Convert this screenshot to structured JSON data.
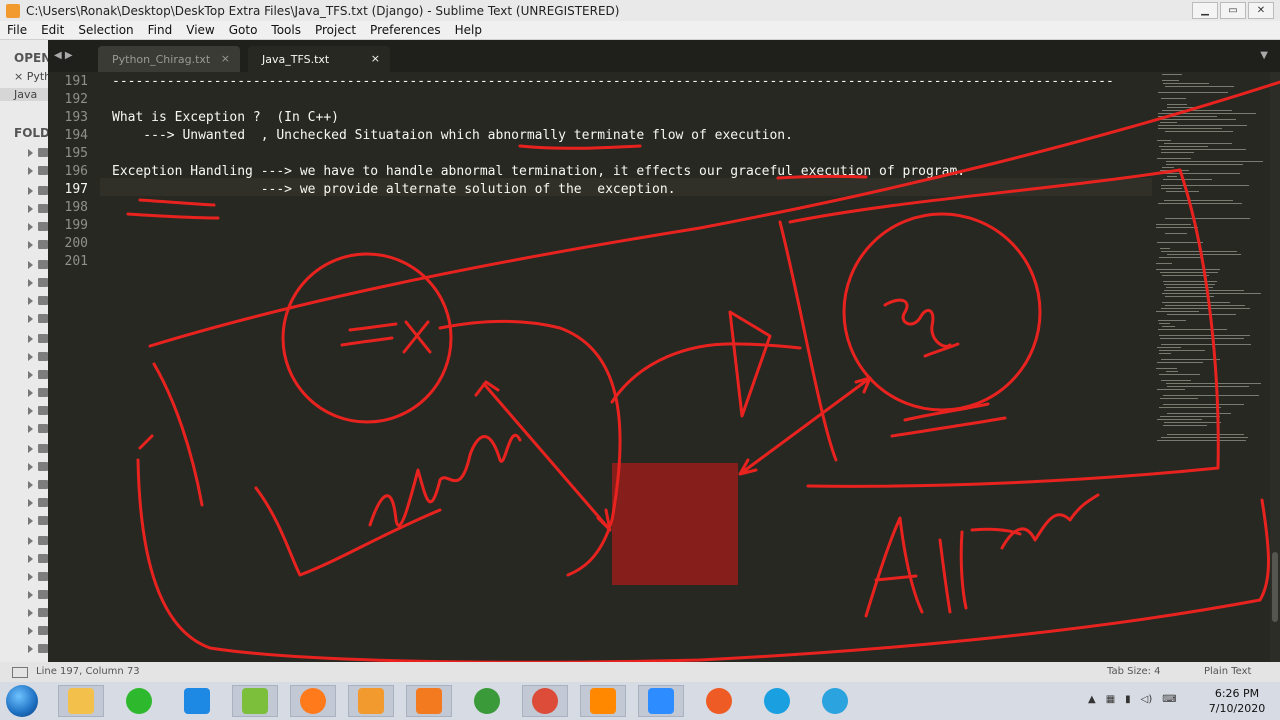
{
  "window": {
    "title": "C:\\Users\\Ronak\\Desktop\\DeskTop Extra Files\\Java_TFS.txt (Django) - Sublime Text (UNREGISTERED)",
    "minimize": "▁",
    "restore": "▭",
    "close": "✕"
  },
  "menu": [
    "File",
    "Edit",
    "Selection",
    "Find",
    "View",
    "Goto",
    "Tools",
    "Project",
    "Preferences",
    "Help"
  ],
  "sidebar": {
    "open_header": "OPEN",
    "open_files": [
      {
        "label": "× Pyth",
        "active": false
      },
      {
        "label": "Java",
        "active": true
      }
    ],
    "folders_header": "FOLD"
  },
  "tabs": [
    {
      "label": "Python_Chirag.txt",
      "close": "×",
      "active": false
    },
    {
      "label": "Java_TFS.txt",
      "close": "×",
      "active": true
    }
  ],
  "editor": {
    "lines": [
      {
        "num": "191",
        "text": "--------------------------------------------------------------------------------------------------------------------------------"
      },
      {
        "num": "192",
        "text": ""
      },
      {
        "num": "193",
        "text": "What is Exception ?  (In C++)"
      },
      {
        "num": "194",
        "text": "    ---> Unwanted  , Unchecked Situataion which abnormally terminate flow of execution."
      },
      {
        "num": "195",
        "text": ""
      },
      {
        "num": "196",
        "text": "Exception Handling ---> we have to handle abnormal termination, it effects our graceful execution of program."
      },
      {
        "num": "197",
        "text": "                   ---> we provide alternate solution of the  exception."
      },
      {
        "num": "198",
        "text": ""
      },
      {
        "num": "199",
        "text": ""
      },
      {
        "num": "200",
        "text": ""
      },
      {
        "num": "201",
        "text": ""
      }
    ],
    "current_line": "197"
  },
  "status": {
    "position": "Line 197, Column 73",
    "tab_size": "Tab Size: 4",
    "syntax": "Plain Text"
  },
  "taskbar": {
    "apps": [
      "start",
      "file-explorer",
      "sync",
      "vscode",
      "notepad-plus-plus",
      "firefox",
      "sublime-text",
      "xampp",
      "git-gui",
      "chrome",
      "vlc",
      "zoom",
      "postman",
      "edge",
      "telegram"
    ],
    "time": "6:26 PM",
    "date": "7/10/2020"
  },
  "annotation": {
    "color": "#e8231f",
    "highlight_color": "#8b1f1b"
  }
}
